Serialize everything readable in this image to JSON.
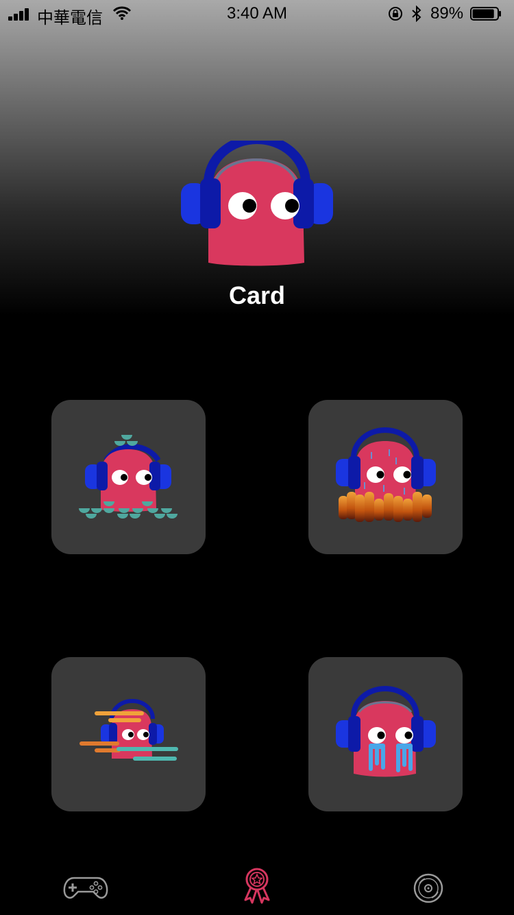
{
  "status_bar": {
    "carrier": "中華電信",
    "time": "3:40 AM",
    "battery_percent": "89%",
    "battery_level": 0.89
  },
  "hero": {
    "title": "Card"
  },
  "cards": [
    {
      "name": "waves"
    },
    {
      "name": "fire-rain"
    },
    {
      "name": "speed"
    },
    {
      "name": "tears"
    }
  ],
  "tabbar": {
    "items": [
      {
        "icon": "gamepad-icon",
        "active": false
      },
      {
        "icon": "award-ribbon-icon",
        "active": true
      },
      {
        "icon": "vinyl-record-icon",
        "active": false
      }
    ],
    "active_color": "#d6365f",
    "inactive_color": "#9a9a9a"
  },
  "colors": {
    "ghost_pink": "#d9385e",
    "headphone_dark": "#0d1aa8",
    "headphone_bright": "#1a35e0",
    "card_bg": "#3a3a3a"
  }
}
